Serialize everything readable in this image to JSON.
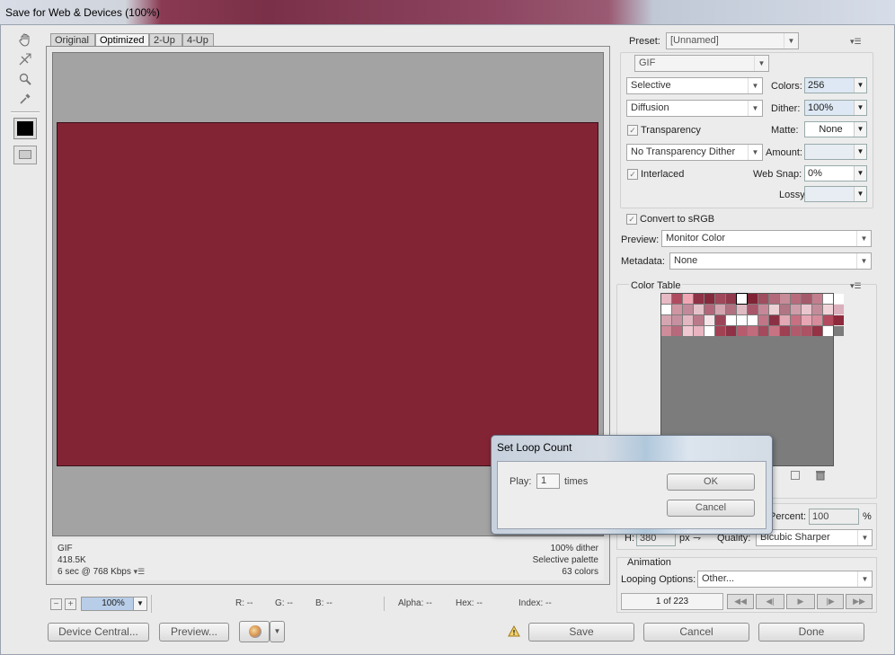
{
  "window": {
    "title": "Save for Web & Devices (100%)"
  },
  "tools": [
    "hand-tool-icon",
    "slice-select-tool-icon",
    "zoom-tool-icon",
    "eyedropper-tool-icon",
    "eyedropper-color-icon",
    "toggle-slices-icon"
  ],
  "tabs": [
    "Original",
    "Optimized",
    "2-Up",
    "4-Up"
  ],
  "active_tab": "Optimized",
  "image_info": {
    "format": "GIF",
    "size": "418.5K",
    "time": "6 sec @ 768 Kbps",
    "dither": "100% dither",
    "palette": "Selective palette",
    "colors": "63 colors"
  },
  "status": {
    "zoom": "100%",
    "r": "R: --",
    "g": "G: --",
    "b": "B: --",
    "alpha": "Alpha: --",
    "hex": "Hex: --",
    "index": "Index: --"
  },
  "buttons": {
    "device_central": "Device Central...",
    "preview": "Preview...",
    "save": "Save",
    "cancel": "Cancel",
    "done": "Done"
  },
  "settings": {
    "preset_label": "Preset:",
    "preset_value": "[Unnamed]",
    "format": "GIF",
    "reduction": "Selective",
    "colors_label": "Colors:",
    "colors_value": "256",
    "dither_algo": "Diffusion",
    "dither_label": "Dither:",
    "dither_value": "100%",
    "transparency_label": "Transparency",
    "matte_label": "Matte:",
    "matte_value": "None",
    "trans_dither": "No Transparency Dither",
    "amount_label": "Amount:",
    "interlaced_label": "Interlaced",
    "websnap_label": "Web Snap:",
    "websnap_value": "0%",
    "lossy_label": "Lossy:",
    "convert_label": "Convert to sRGB",
    "preview_label": "Preview:",
    "preview_value": "Monitor Color",
    "metadata_label": "Metadata:",
    "metadata_value": "None"
  },
  "color_table": {
    "title": "Color Table",
    "swatches": [
      "#e7b9c4",
      "#b04a5f",
      "#f2a6b4",
      "#8e3246",
      "#86293b",
      "#a0475a",
      "#91394b",
      "#ffffff",
      "#7f2335",
      "#a04d60",
      "#b26a7a",
      "#c88b98",
      "#b96b7c",
      "#a35a6a",
      "#c37d8c",
      "#ffffff",
      "#ffffff",
      "#ffffff",
      "#cf96a2",
      "#c2899a",
      "#e4c2ca",
      "#b36679",
      "#d3a5b0",
      "#b17080",
      "#e0bac3",
      "#a8566a",
      "#c68898",
      "#ecd0d6",
      "#b27584",
      "#cf9da9",
      "#e9c6ce",
      "#c48c9b",
      "#f0d4da",
      "#dbaebb",
      "#d5a6b2",
      "#c790a0",
      "#e3b7c2",
      "#ba7a8a",
      "#f6e4e8",
      "#9c4559",
      "#ffffff",
      "#ffffff",
      "#ffffff",
      "#c17587",
      "#8b3044",
      "#e2a8b4",
      "#c96f82",
      "#e6a6b3",
      "#d88b9b",
      "#b34a5e",
      "#8e2a3c",
      "#cf8c9b",
      "#b8697b",
      "#f0c8d1",
      "#e8b4c0",
      "#ffffff",
      "#a34154",
      "#8f3247",
      "#b95b6d",
      "#c06c7d",
      "#a5495c",
      "#c87383",
      "#9e3f52",
      "#b25a6b",
      "#ab5264",
      "#953244",
      "#ffffff",
      "#7c7c7c"
    ]
  },
  "dialog": {
    "title": "Set Loop Count",
    "play_label": "Play:",
    "play_value": "1",
    "times_label": "times",
    "ok": "OK",
    "cancel": "Cancel"
  },
  "image_size": {
    "percent_label": "Percent:",
    "percent_value": "100",
    "percent_unit": "%",
    "h_label": "H:",
    "h_value": "380",
    "h_unit": "px",
    "quality_label": "Quality:",
    "quality_value": "Bicubic Sharper"
  },
  "animation": {
    "title": "Animation",
    "looping_label": "Looping Options:",
    "looping_value": "Other...",
    "frame_counter": "1 of 223"
  }
}
